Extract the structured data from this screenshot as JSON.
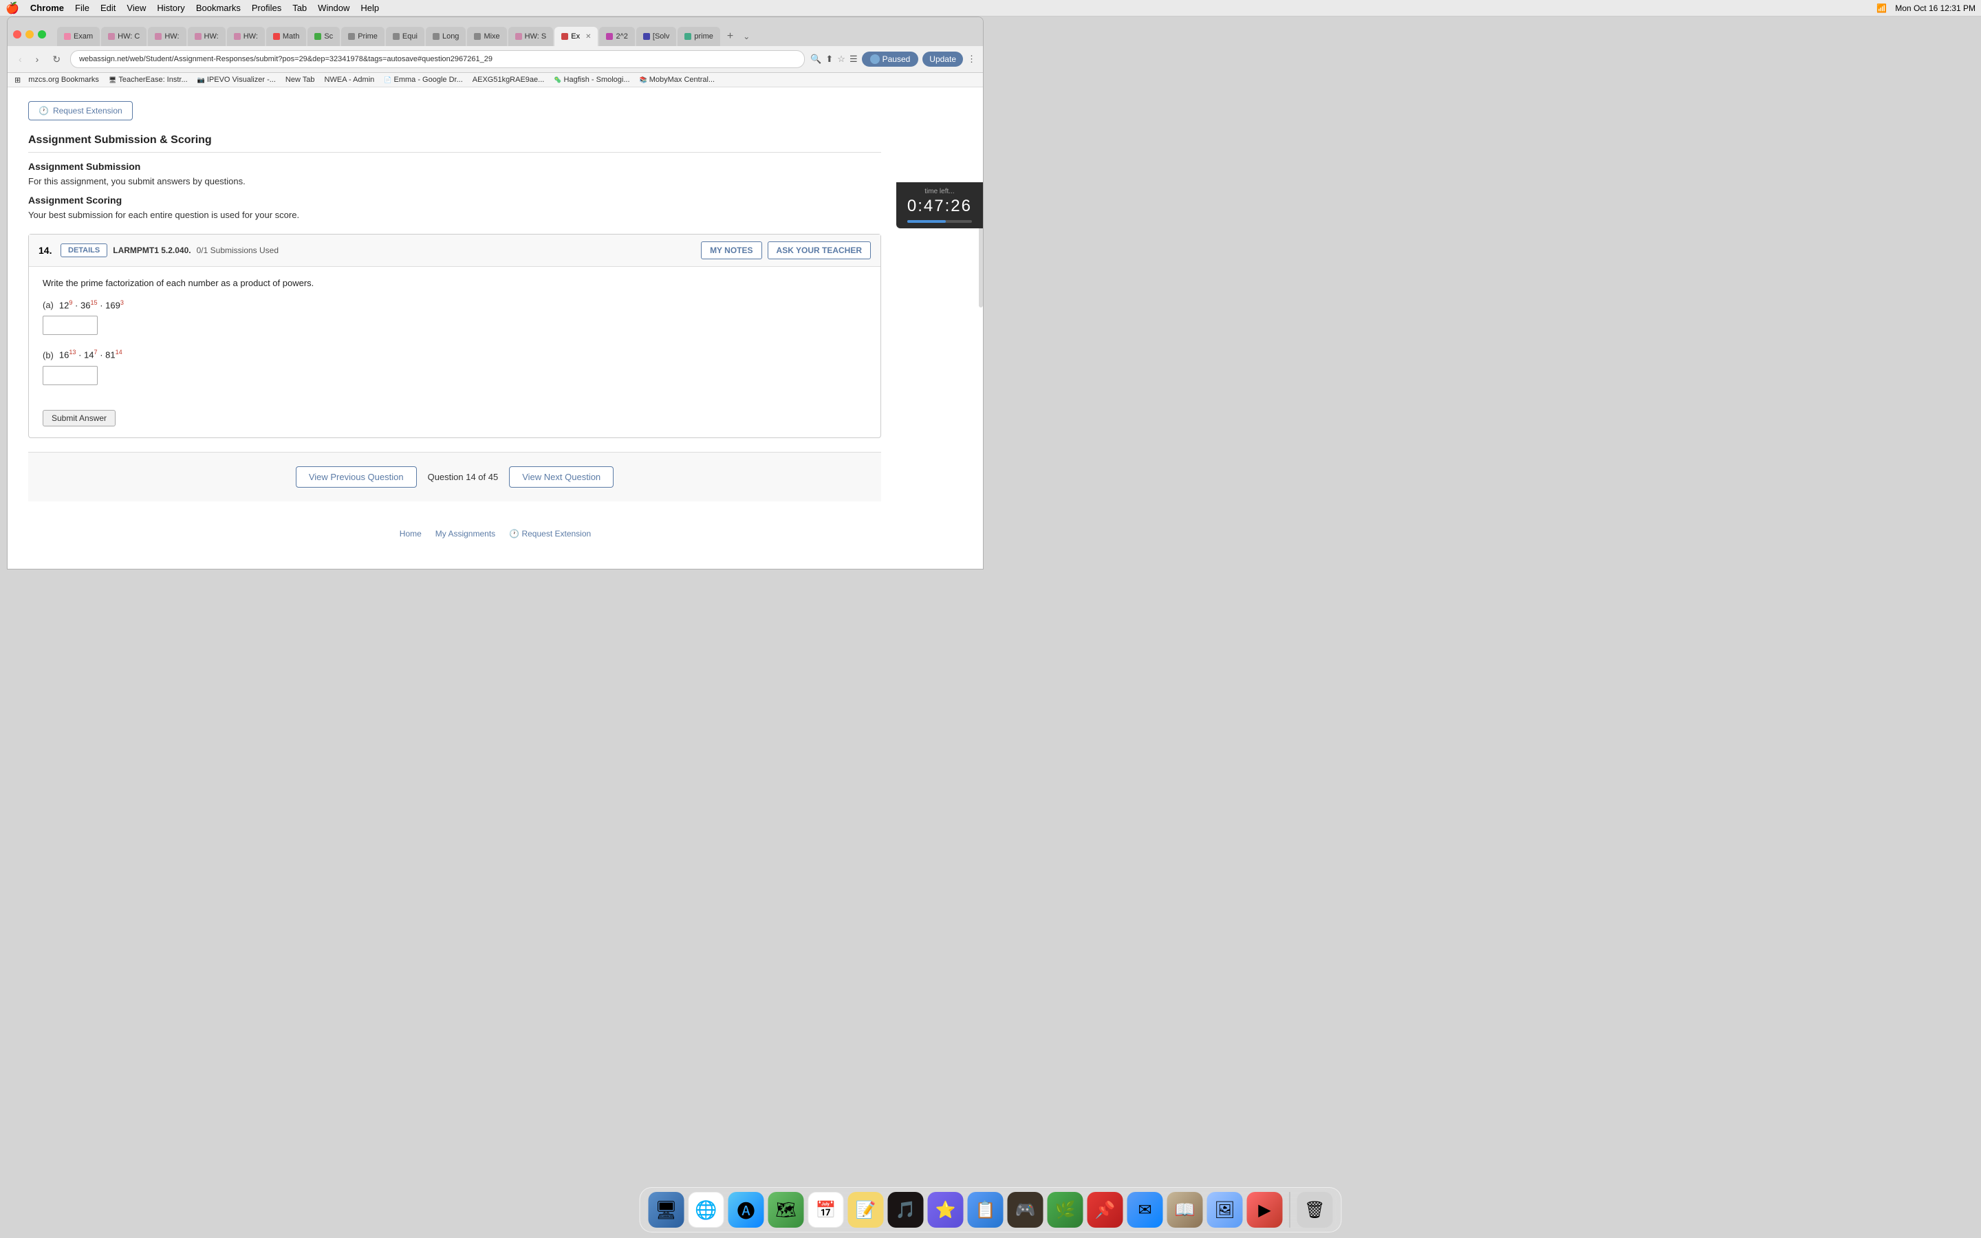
{
  "menubar": {
    "apple": "🍎",
    "items": [
      "Chrome",
      "File",
      "Edit",
      "View",
      "History",
      "Bookmarks",
      "Profiles",
      "Tab",
      "Window",
      "Help"
    ],
    "right": [
      "Mon Oct 16  12:31 PM"
    ]
  },
  "tabs": [
    {
      "label": "Exam",
      "favicon_color": "#e8a",
      "active": false
    },
    {
      "label": "HW: C",
      "favicon_color": "#c8a",
      "active": false
    },
    {
      "label": "HW:",
      "favicon_color": "#c8a",
      "active": false
    },
    {
      "label": "HW:",
      "favicon_color": "#c8a",
      "active": false
    },
    {
      "label": "HW:",
      "favicon_color": "#c8a",
      "active": false
    },
    {
      "label": "Math",
      "favicon_color": "#e44",
      "active": false
    },
    {
      "label": "Sc",
      "favicon_color": "#4a4",
      "active": false
    },
    {
      "label": "Prime",
      "favicon_color": "#888",
      "active": false
    },
    {
      "label": "Equi",
      "favicon_color": "#888",
      "active": false
    },
    {
      "label": "Long",
      "favicon_color": "#888",
      "active": false
    },
    {
      "label": "Mixe",
      "favicon_color": "#888",
      "active": false
    },
    {
      "label": "HW: S",
      "favicon_color": "#c8a",
      "active": false
    },
    {
      "label": "Ex",
      "favicon_color": "#c44",
      "active": true
    },
    {
      "label": "2^2",
      "favicon_color": "#b4a",
      "active": false
    },
    {
      "label": "[Solv",
      "favicon_color": "#44a",
      "active": false
    },
    {
      "label": "prime",
      "favicon_color": "#4a8",
      "active": false
    }
  ],
  "nav": {
    "url": "webassign.net/web/Student/Assignment-Responses/submit?pos=29&dep=32341978&tags=autosave#question2967261_29",
    "paused_label": "Paused",
    "update_label": "Update"
  },
  "bookmarks": [
    "mzcs.org Bookmarks",
    "TeacherEase: Instr...",
    "IPEVO Visualizer -...",
    "New Tab",
    "NWEA - Admin",
    "Emma - Google Dr...",
    "AEXG51kgRAE9ae...",
    "Hagfish - Smologi...",
    "MobyMax Central..."
  ],
  "timer": {
    "label": "time left...",
    "minutes": "0",
    "separator1": ":",
    "seconds_tens": "47",
    "separator2": ":",
    "seconds_ones": "26"
  },
  "request_ext": {
    "label": "Request Extension"
  },
  "assignment_section": {
    "title": "Assignment Submission & Scoring",
    "submission_title": "Assignment Submission",
    "submission_text": "For this assignment, you submit answers by questions.",
    "scoring_title": "Assignment Scoring",
    "scoring_text": "Your best submission for each entire question is used for your score."
  },
  "question": {
    "number": "14.",
    "details_label": "DETAILS",
    "reference": "LARMPMT1 5.2.040.",
    "submissions": "0/1 Submissions Used",
    "my_notes_label": "MY NOTES",
    "ask_teacher_label": "ASK YOUR TEACHER",
    "instruction": "Write the prime factorization of each number as a product of powers.",
    "sub_a": {
      "letter": "(a)",
      "expr_base1": "12",
      "expr_exp1": "9",
      "expr_mid": "· 36",
      "expr_exp2": "15",
      "expr_mid2": "· 169",
      "expr_exp3": "3"
    },
    "sub_b": {
      "letter": "(b)",
      "expr_base1": "16",
      "expr_exp1": "13",
      "expr_mid": "· 14",
      "expr_exp2": "7",
      "expr_mid2": "· 81",
      "expr_exp3": "14"
    },
    "submit_label": "Submit Answer"
  },
  "footer_nav": {
    "prev_label": "View Previous Question",
    "indicator": "Question 14 of 45",
    "next_label": "View Next Question"
  },
  "page_footer": {
    "home_label": "Home",
    "assignments_label": "My Assignments",
    "request_ext_label": "Request Extension"
  },
  "dock_apps": [
    {
      "name": "Finder",
      "color": "#5b8fc9",
      "emoji": "🖥"
    },
    {
      "name": "Chrome",
      "color": "#4a90d9",
      "emoji": "🌐"
    },
    {
      "name": "AppStore",
      "color": "#5bc8f5",
      "emoji": "🅐"
    },
    {
      "name": "Maps",
      "color": "#6abf69",
      "emoji": "🗺"
    },
    {
      "name": "Calendar",
      "color": "#e8524a",
      "emoji": "📅"
    },
    {
      "name": "Notes",
      "color": "#f5d76e",
      "emoji": "📝"
    },
    {
      "name": "Spotify",
      "color": "#2ebd59",
      "emoji": "🎵"
    },
    {
      "name": "GoodNotes",
      "color": "#7b68ee",
      "emoji": "⭐"
    },
    {
      "name": "Copies",
      "color": "#5b9cf6",
      "emoji": "📋"
    },
    {
      "name": "Game",
      "color": "#5a4e44",
      "emoji": "🎮"
    },
    {
      "name": "Leaf",
      "color": "#4caf50",
      "emoji": "🌿"
    },
    {
      "name": "Spike",
      "color": "#e53935",
      "emoji": "📌"
    },
    {
      "name": "Mail",
      "color": "#5b9cf6",
      "emoji": "✉"
    },
    {
      "name": "Dictionary",
      "color": "#8b7355",
      "emoji": "📖"
    },
    {
      "name": "Preview",
      "color": "#a0c4ff",
      "emoji": "🖼"
    },
    {
      "name": "QuickTime",
      "color": "#c0392b",
      "emoji": "▶"
    },
    {
      "name": "Trash",
      "color": "#888",
      "emoji": "🗑"
    }
  ]
}
